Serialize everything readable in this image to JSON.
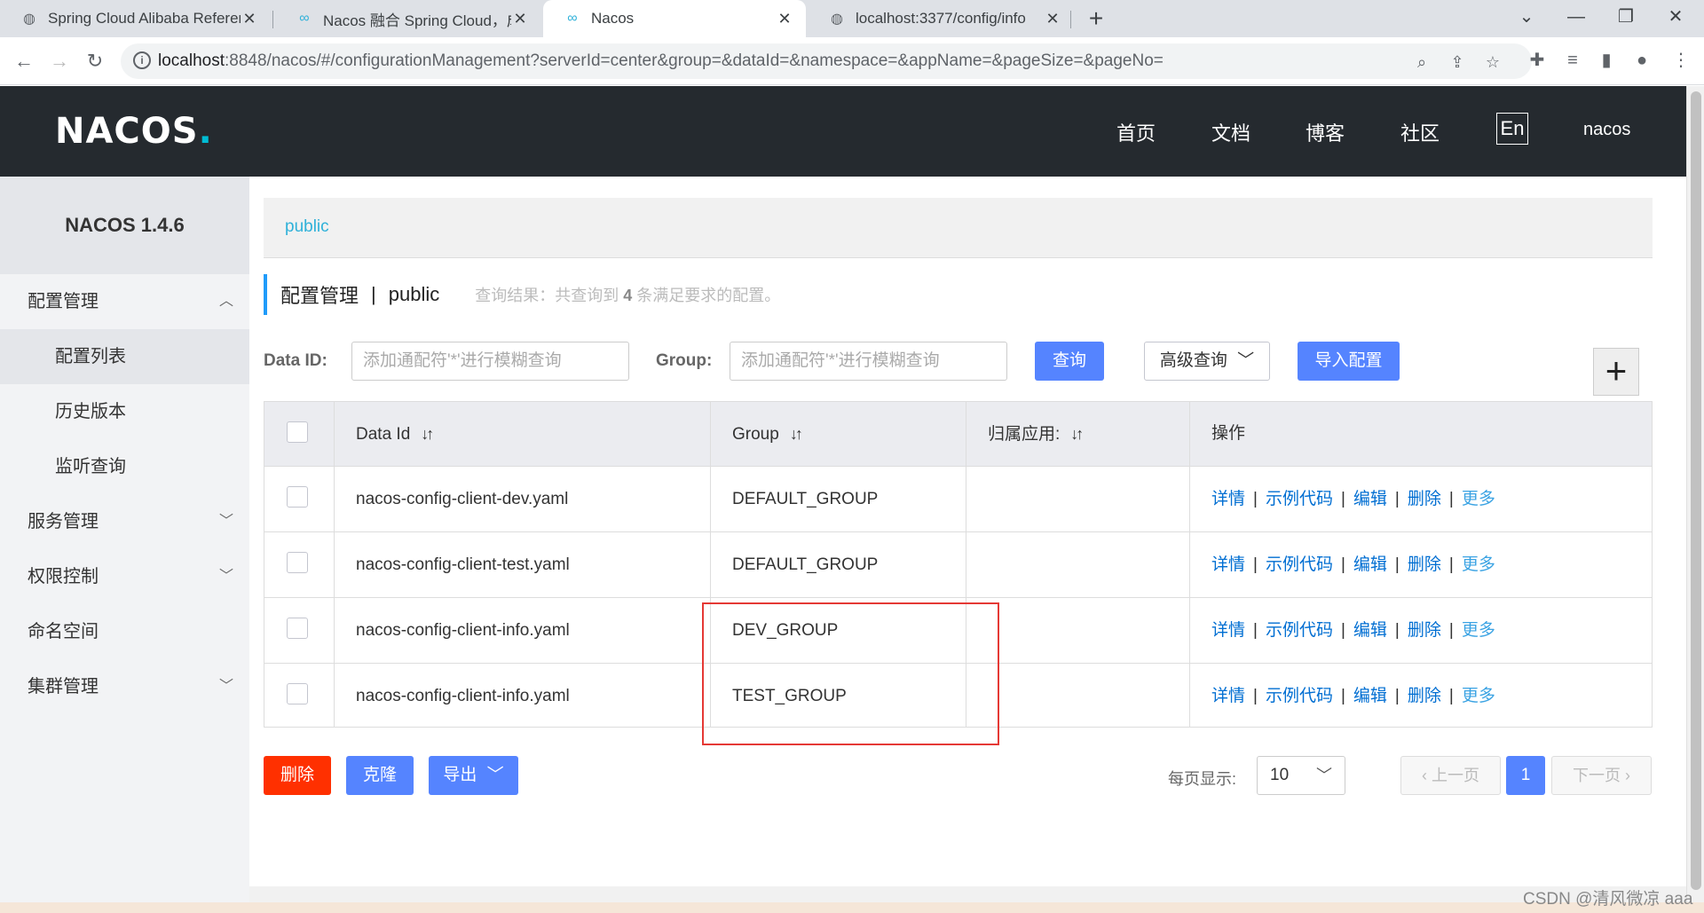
{
  "browser": {
    "tabs": [
      {
        "title": "Spring Cloud Alibaba Referenc",
        "icon": "globe-icon"
      },
      {
        "title": "Nacos 融合 Spring Cloud，成为",
        "icon": "nacos-icon"
      },
      {
        "title": "Nacos",
        "icon": "nacos-icon"
      },
      {
        "title": "localhost:3377/config/info",
        "icon": "globe-icon"
      }
    ],
    "url_host": "localhost",
    "url_rest": ":8848/nacos/#/configurationManagement?serverId=center&group=&dataId=&namespace=&appName=&pageSize=&pageNo="
  },
  "header": {
    "logo": "NACOS",
    "logo_dot": ".",
    "nav": [
      "首页",
      "文档",
      "博客",
      "社区"
    ],
    "lang": "En",
    "user": "nacos"
  },
  "sidebar": {
    "title": "NACOS 1.4.6",
    "items": [
      {
        "label": "配置管理"
      },
      {
        "label": "配置列表"
      },
      {
        "label": "历史版本"
      },
      {
        "label": "监听查询"
      },
      {
        "label": "服务管理"
      },
      {
        "label": "权限控制"
      },
      {
        "label": "命名空间"
      },
      {
        "label": "集群管理"
      }
    ]
  },
  "main": {
    "namespace_tab": "public",
    "page_title": "配置管理",
    "page_sep": "|",
    "page_ns": "public",
    "result_prefix": "查询结果：共查询到",
    "result_count": "4",
    "result_suffix": "条满足要求的配置。",
    "filter": {
      "dataid_label": "Data ID:",
      "dataid_placeholder": "添加通配符'*'进行模糊查询",
      "group_label": "Group:",
      "group_placeholder": "添加通配符'*'进行模糊查询",
      "query_btn": "查询",
      "advanced_btn": "高级查询",
      "import_btn": "导入配置",
      "plus": "+"
    },
    "table": {
      "headers": [
        "Data Id",
        "Group",
        "归属应用:",
        "操作"
      ],
      "sort_icon": "↓↑",
      "rows": [
        {
          "dataId": "nacos-config-client-dev.yaml",
          "group": "DEFAULT_GROUP",
          "app": ""
        },
        {
          "dataId": "nacos-config-client-test.yaml",
          "group": "DEFAULT_GROUP",
          "app": ""
        },
        {
          "dataId": "nacos-config-client-info.yaml",
          "group": "DEV_GROUP",
          "app": ""
        },
        {
          "dataId": "nacos-config-client-info.yaml",
          "group": "TEST_GROUP",
          "app": ""
        }
      ],
      "ops": {
        "detail": "详情",
        "sample": "示例代码",
        "edit": "编辑",
        "delete": "删除",
        "more": "更多",
        "bar": "|"
      }
    },
    "footer": {
      "delete_btn": "删除",
      "clone_btn": "克隆",
      "export_btn": "导出",
      "page_size_label": "每页显示:",
      "page_size": "10",
      "prev": "上一页",
      "current_page": "1",
      "next": "下一页"
    }
  },
  "watermark": "CSDN @清风微凉 aaa"
}
